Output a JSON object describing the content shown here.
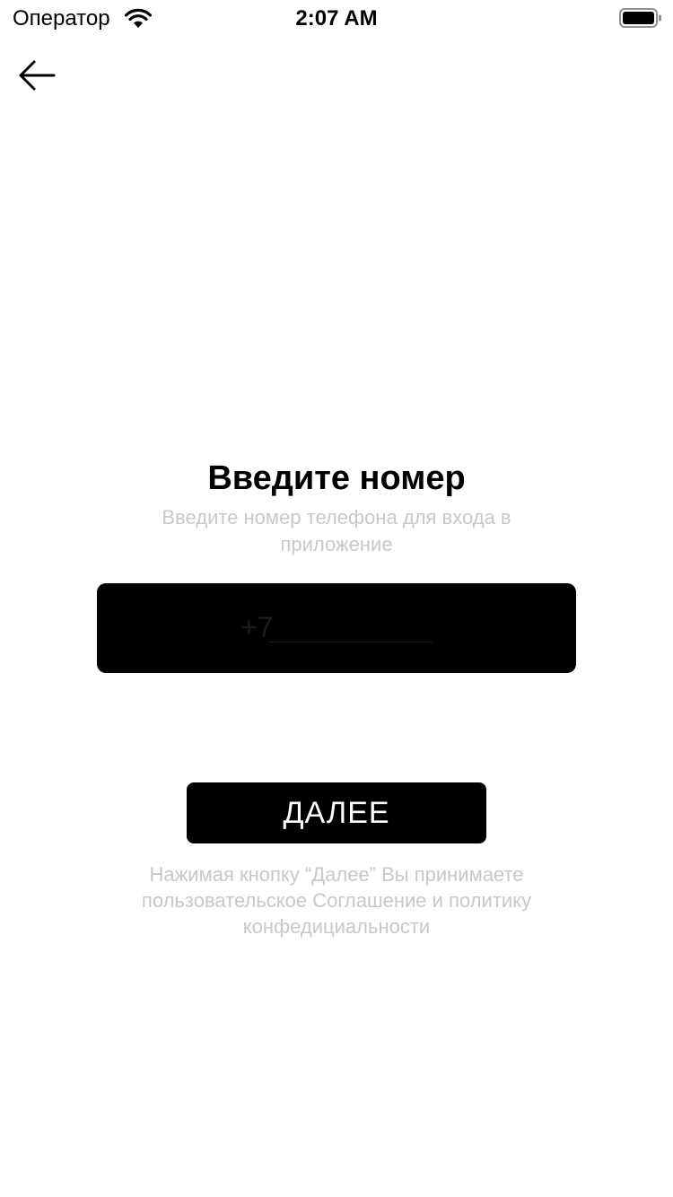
{
  "status_bar": {
    "carrier": "Оператор",
    "time": "2:07 AM",
    "icons": [
      "wifi-icon",
      "battery-icon"
    ]
  },
  "nav": {
    "back_icon": "arrow-left-icon"
  },
  "main": {
    "title": "Введите номер",
    "subtitle": "Введите номер телефона для входа в приложение",
    "phone_placeholder": "+7",
    "next_label": "ДАЛЕЕ",
    "agreement": "Нажимая кнопку “Далее” Вы принимаете пользовательское Соглашение и политику конфедициальности"
  },
  "colors": {
    "primary": "#000000",
    "muted_text": "#c7c7cc",
    "background": "#ffffff"
  }
}
